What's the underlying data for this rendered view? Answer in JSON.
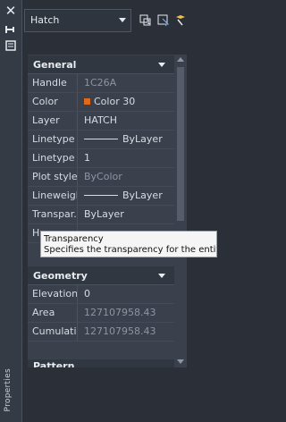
{
  "sidebar": {
    "vertical_label": "Properties"
  },
  "toolbar": {
    "object_type": "Hatch"
  },
  "sections": {
    "general": "General",
    "geometry": "Geometry",
    "pattern_partial": "Pattern"
  },
  "general_rows": [
    {
      "label": "Handle",
      "value": "1C26A",
      "value_style": "muted"
    },
    {
      "label": "Color",
      "value": "Color 30",
      "swatch_color": "#e06a1b"
    },
    {
      "label": "Layer",
      "value": "HATCH"
    },
    {
      "label": "Linetype",
      "value": "ByLayer",
      "has_line": true
    },
    {
      "label": "Linetype ...",
      "value": "1"
    },
    {
      "label": "Plot style",
      "value": "ByColor",
      "value_style": "muted"
    },
    {
      "label": "Lineweight",
      "value": "ByLayer",
      "has_line": true
    },
    {
      "label": "Transpar...",
      "value": "ByLayer"
    },
    {
      "label": "H",
      "value": ""
    }
  ],
  "geometry_rows": [
    {
      "label": "Elevation",
      "value": "0"
    },
    {
      "label": "Area",
      "value": "127107958.43",
      "value_style": "muted"
    },
    {
      "label": "Cumulati...",
      "value": "127107958.43",
      "value_style": "muted"
    }
  ],
  "tooltip": {
    "title": "Transparency",
    "description": "Specifies the transparency for the entity."
  },
  "colors": {
    "background": "#2b3038",
    "panel": "#3a414c",
    "accent_orange": "#e06a1b"
  },
  "icons": [
    "close-icon",
    "pin-icon",
    "properties-menu-icon",
    "select-objects-icon",
    "quick-select-icon",
    "toggle-pickadd-icon"
  ]
}
